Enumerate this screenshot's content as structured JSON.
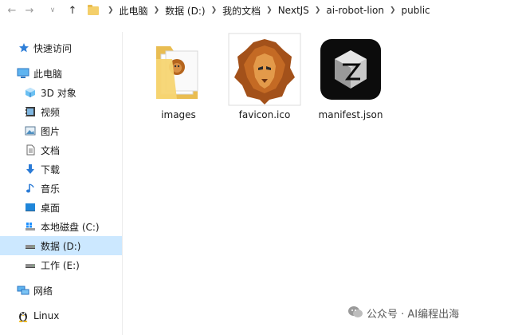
{
  "breadcrumbs": [
    "此电脑",
    "数据 (D:)",
    "我的文档",
    "NextJS",
    "ai-robot-lion",
    "public"
  ],
  "sidebar": {
    "quick_access": "快速访问",
    "this_pc": "此电脑",
    "items": [
      "3D 对象",
      "视频",
      "图片",
      "文档",
      "下载",
      "音乐",
      "桌面",
      "本地磁盘 (C:)",
      "数据 (D:)",
      "工作 (E:)"
    ],
    "network": "网络",
    "linux": "Linux",
    "selected": "数据 (D:)"
  },
  "files": [
    {
      "name": "images",
      "type": "folder"
    },
    {
      "name": "favicon.ico",
      "type": "icon"
    },
    {
      "name": "manifest.json",
      "type": "json"
    }
  ],
  "watermark": "公众号 · AI编程出海",
  "colors": {
    "selected": "#cce8ff",
    "folder": "#f4cf6a",
    "accent": "#1e78d6"
  }
}
